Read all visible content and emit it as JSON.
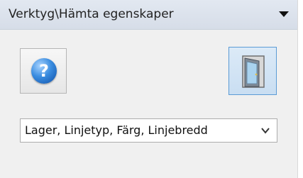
{
  "panel": {
    "title": "Verktyg\\Hämta egenskaper",
    "help_symbol": "?",
    "combo": {
      "selected": "Lager, Linjetyp, Färg, Linjebredd"
    }
  },
  "icons": {
    "dropdown": "chevron-down-icon",
    "help": "help-icon",
    "exit": "door-icon"
  },
  "colors": {
    "titlebar": "#d6dde8",
    "accent_border": "#5b9bd5",
    "help_blue": "#3b8de0"
  }
}
